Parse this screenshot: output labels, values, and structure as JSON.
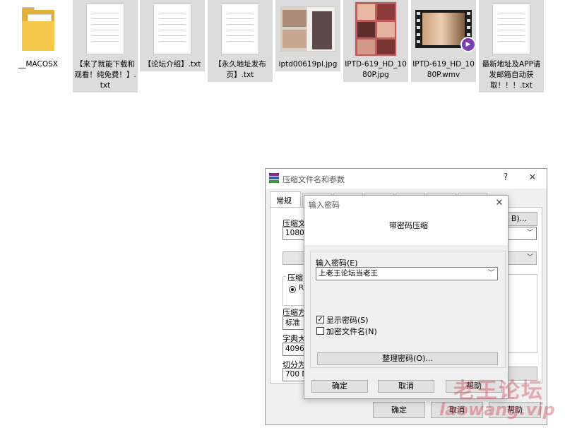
{
  "files": [
    {
      "name": "__MACOSX",
      "type": "folder"
    },
    {
      "name": "【来了就能下载和观看！纯免费！】.txt",
      "type": "txt"
    },
    {
      "name": "【论坛介绍】.txt",
      "type": "txt"
    },
    {
      "name": "【永久地址发布页】.txt",
      "type": "txt"
    },
    {
      "name": "iptd00619pl.jpg",
      "type": "jpg"
    },
    {
      "name": "IPTD-619_HD_1080P.jpg",
      "type": "jpg"
    },
    {
      "name": "IPTD-619_HD_1080P.wmv",
      "type": "wmv"
    },
    {
      "name": "最新地址及APP请发邮箱自动获取！！！.txt",
      "type": "txt"
    }
  ],
  "archive_dialog": {
    "title": "压缩文件名和参数",
    "help_symbol": "?",
    "close_symbol": "✕",
    "tab_general": "常规",
    "archive_name_label": "压缩文",
    "archive_name_value": "1080P.",
    "browse_button": "B)...",
    "format_group_label": "压缩",
    "format_radio_label": "RA",
    "method_label": "压缩方",
    "method_value": "标准",
    "dict_label": "字典大",
    "dict_value": "4096 K",
    "split_label": "切分为",
    "split_value": "700 MB",
    "ok_button": "确定",
    "cancel_button": "取消",
    "help_button": "帮助"
  },
  "password_dialog": {
    "title": "输入密码",
    "close_symbol": "✕",
    "heading": "带密码压缩",
    "password_label": "输入密码(E)",
    "password_value": "上老王论坛当老王",
    "show_password_label": "显示密码(S)",
    "show_password_checked": true,
    "encrypt_names_label": "加密文件名(N)",
    "encrypt_names_checked": false,
    "organize_button": "整理密码(O)...",
    "ok_button": "确定",
    "cancel_button": "取消",
    "help_button": "帮助"
  },
  "watermark": {
    "line1": "老王论坛",
    "line2": "laowang.vip",
    "color": "#d2505a"
  }
}
